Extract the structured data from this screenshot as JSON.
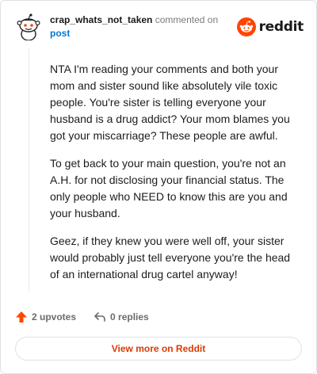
{
  "header": {
    "username": "crap_whats_not_taken",
    "action_text": "commented on",
    "post_link": "post",
    "logo_text": "reddit"
  },
  "comment": {
    "paragraphs": [
      "NTA I'm reading your comments and both your mom and sister sound like absolutely vile toxic people. You're sister is telling everyone your husband is a drug addict? Your mom blames you got your miscarriage? These people are awful.",
      "To get back to your main question, you're not an A.H. for not disclosing your financial status. The only people who NEED to know this are you and your husband.",
      "Geez, if they knew you were well off, your sister would probably just tell everyone you're the head of an international drug cartel anyway!"
    ]
  },
  "actions": {
    "upvotes_label": "2 upvotes",
    "replies_label": "0 replies"
  },
  "footer": {
    "view_more_label": "View more on Reddit"
  },
  "colors": {
    "reddit_orange": "#ff4500",
    "link_blue": "#0079d3",
    "view_more_text": "#d93a00"
  }
}
